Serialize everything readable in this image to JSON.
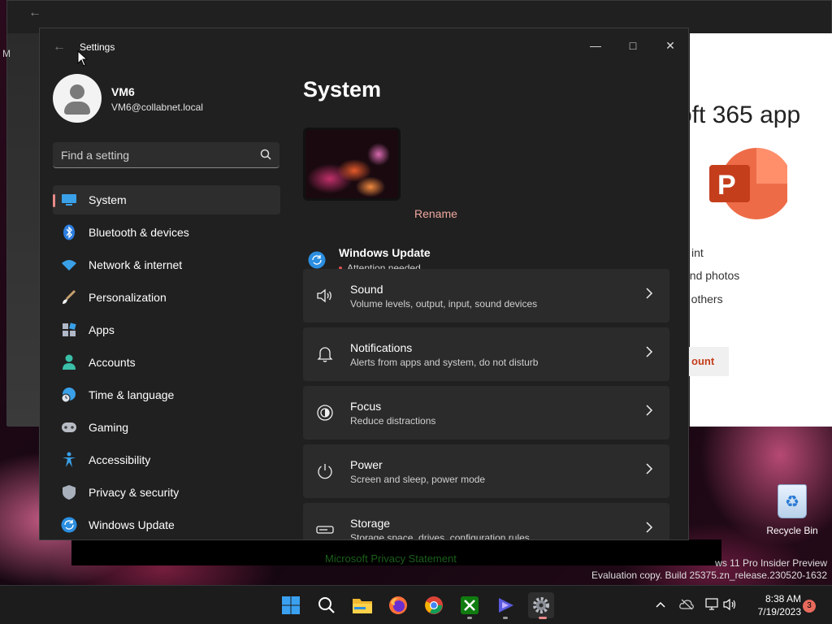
{
  "background": {
    "m365_title": "oft 365 app",
    "m_letter": "M",
    "lines": [
      "int",
      "and photos",
      "n others"
    ],
    "button_label": "ount",
    "privacy_link": "Microsoft Privacy Statement",
    "watermark_line1": "ws 11 Pro Insider Preview",
    "watermark_line2": "Evaluation copy. Build 25375.zn_release.230520-1632"
  },
  "settings": {
    "window_title": "Settings",
    "user": {
      "name": "VM6",
      "email": "VM6@collabnet.local"
    },
    "search": {
      "placeholder": "Find a setting"
    },
    "nav": [
      {
        "label": "System",
        "icon": "system-icon",
        "active": true
      },
      {
        "label": "Bluetooth & devices",
        "icon": "bluetooth-icon"
      },
      {
        "label": "Network & internet",
        "icon": "wifi-icon"
      },
      {
        "label": "Personalization",
        "icon": "brush-icon"
      },
      {
        "label": "Apps",
        "icon": "apps-icon"
      },
      {
        "label": "Accounts",
        "icon": "accounts-icon"
      },
      {
        "label": "Time & language",
        "icon": "globe-clock-icon"
      },
      {
        "label": "Gaming",
        "icon": "gamepad-icon"
      },
      {
        "label": "Accessibility",
        "icon": "accessibility-icon"
      },
      {
        "label": "Privacy & security",
        "icon": "shield-icon"
      },
      {
        "label": "Windows Update",
        "icon": "update-icon"
      }
    ],
    "main": {
      "title": "System",
      "rename_label": "Rename",
      "windows_update": {
        "title": "Windows Update",
        "status": "Attention needed"
      },
      "cards": [
        {
          "title": "Sound",
          "subtitle": "Volume levels, output, input, sound devices",
          "icon": "speaker-icon"
        },
        {
          "title": "Notifications",
          "subtitle": "Alerts from apps and system, do not disturb",
          "icon": "bell-icon"
        },
        {
          "title": "Focus",
          "subtitle": "Reduce distractions",
          "icon": "focus-icon"
        },
        {
          "title": "Power",
          "subtitle": "Screen and sleep, power mode",
          "icon": "power-icon"
        },
        {
          "title": "Storage",
          "subtitle": "Storage space, drives, configuration rules",
          "icon": "storage-icon"
        }
      ]
    }
  },
  "desktop": {
    "recycle_bin_label": "Recycle Bin"
  },
  "taskbar": {
    "time": "8:38 AM",
    "date": "7/19/2023",
    "notification_count": "3"
  },
  "colors": {
    "accent_pink": "#e88a8a",
    "rename_text": "#f0a8a0",
    "update_blue": "#4aa6e8",
    "notification_badge": "#e86a5c"
  }
}
